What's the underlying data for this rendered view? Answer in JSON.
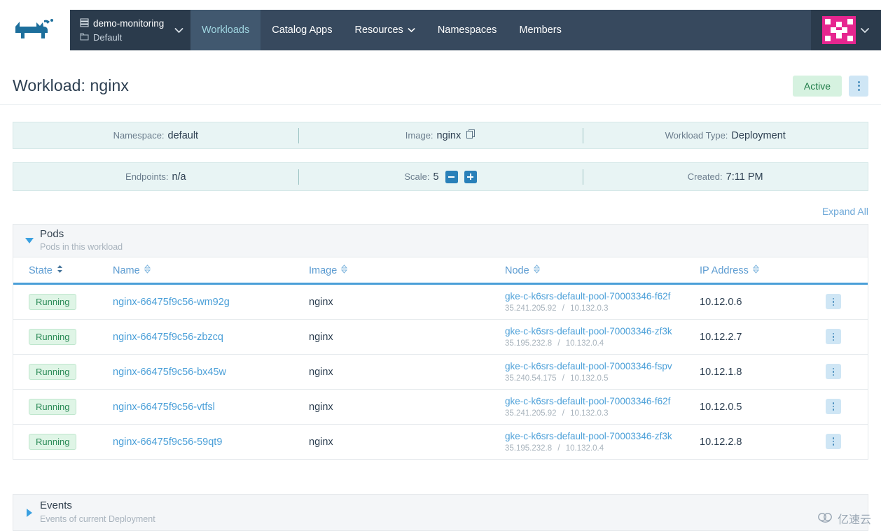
{
  "topnav": {
    "logo_icon": "rancher-cow-logo",
    "cluster_icon": "cluster-stack-icon",
    "cluster_name": "demo-monitoring",
    "project_icon": "folder-icon",
    "project_name": "Default",
    "cluster_chevron_icon": "chevron-down-icon",
    "nav_items": [
      {
        "label": "Workloads",
        "active": true,
        "has_caret": false
      },
      {
        "label": "Catalog Apps",
        "active": false,
        "has_caret": false
      },
      {
        "label": "Resources",
        "active": false,
        "has_caret": true
      },
      {
        "label": "Namespaces",
        "active": false,
        "has_caret": false
      },
      {
        "label": "Members",
        "active": false,
        "has_caret": false
      }
    ],
    "avatar_icon": "user-avatar-identicon",
    "avatar_color": "#e6268f",
    "avatar_chevron_icon": "chevron-down-icon",
    "bar_color": "#37495e",
    "active_color": "#9fd5e0"
  },
  "page": {
    "title": "Workload: nginx",
    "status_badge": "Active",
    "status_badge_color": "#1d7a46",
    "actions_icon": "kebab-menu-icon"
  },
  "info_row_1": [
    {
      "label": "Namespace:",
      "value": "default"
    },
    {
      "label": "Image:",
      "value": "nginx",
      "icon": "copy-icon"
    },
    {
      "label": "Workload Type:",
      "value": "Deployment"
    }
  ],
  "info_row_2": [
    {
      "label": "Endpoints:",
      "value": "n/a"
    },
    {
      "label": "Scale:",
      "value": "5",
      "minus_icon": "minus-icon",
      "plus_icon": "plus-icon"
    },
    {
      "label": "Created:",
      "value": "7:11 PM"
    }
  ],
  "expand_all": "Expand All",
  "pods_section": {
    "arrow_icon": "triangle-down-icon",
    "title": "Pods",
    "subtitle": "Pods in this workload"
  },
  "events_section": {
    "arrow_icon": "triangle-right-icon",
    "title": "Events",
    "subtitle": "Events of current Deployment"
  },
  "table": {
    "columns": [
      {
        "label": "State",
        "sort_icon": "sort-updown-icon"
      },
      {
        "label": "Name",
        "sort_icon": "sort-updown-icon"
      },
      {
        "label": "Image",
        "sort_icon": "sort-updown-icon"
      },
      {
        "label": "Node",
        "sort_icon": "sort-updown-icon"
      },
      {
        "label": "IP Address",
        "sort_icon": "sort-updown-icon"
      }
    ],
    "rows": [
      {
        "state": "Running",
        "name": "nginx-66475f9c56-wm92g",
        "image": "nginx",
        "node": "gke-c-k6srs-default-pool-70003346-f62f",
        "node_external_ip": "35.241.205.92",
        "node_internal_ip": "10.132.0.3",
        "ip": "10.12.0.6",
        "actions_icon": "kebab-menu-icon"
      },
      {
        "state": "Running",
        "name": "nginx-66475f9c56-zbzcq",
        "image": "nginx",
        "node": "gke-c-k6srs-default-pool-70003346-zf3k",
        "node_external_ip": "35.195.232.8",
        "node_internal_ip": "10.132.0.4",
        "ip": "10.12.2.7",
        "actions_icon": "kebab-menu-icon"
      },
      {
        "state": "Running",
        "name": "nginx-66475f9c56-bx45w",
        "image": "nginx",
        "node": "gke-c-k6srs-default-pool-70003346-fspv",
        "node_external_ip": "35.240.54.175",
        "node_internal_ip": "10.132.0.5",
        "ip": "10.12.1.8",
        "actions_icon": "kebab-menu-icon"
      },
      {
        "state": "Running",
        "name": "nginx-66475f9c56-vtfsl",
        "image": "nginx",
        "node": "gke-c-k6srs-default-pool-70003346-f62f",
        "node_external_ip": "35.241.205.92",
        "node_internal_ip": "10.132.0.3",
        "ip": "10.12.0.5",
        "actions_icon": "kebab-menu-icon"
      },
      {
        "state": "Running",
        "name": "nginx-66475f9c56-59qt9",
        "image": "nginx",
        "node": "gke-c-k6srs-default-pool-70003346-zf3k",
        "node_external_ip": "35.195.232.8",
        "node_internal_ip": "10.132.0.4",
        "ip": "10.12.2.8",
        "actions_icon": "kebab-menu-icon"
      }
    ],
    "ip_separator": "/"
  },
  "watermark": {
    "icon": "cloud-logo-icon",
    "text": "亿速云"
  }
}
